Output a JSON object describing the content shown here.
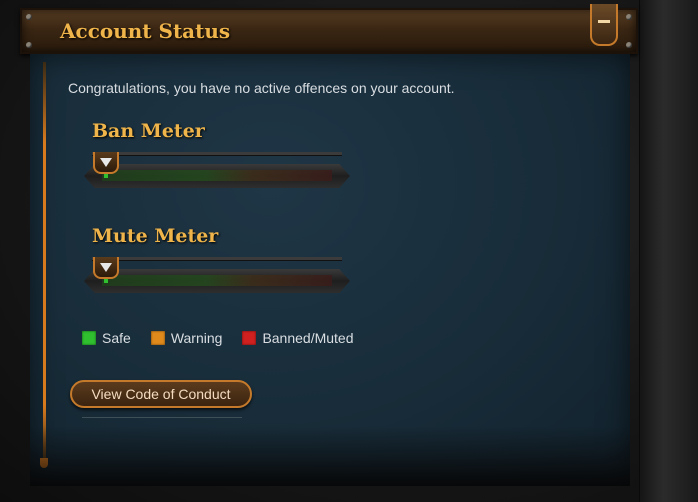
{
  "header": {
    "title": "Account Status"
  },
  "message": "Congratulations, you have no active offences on your account.",
  "meters": [
    {
      "title": "Ban Meter",
      "level": 0.0
    },
    {
      "title": "Mute Meter",
      "level": 0.0
    }
  ],
  "legend": [
    {
      "label": "Safe",
      "color": "#2fbf2f"
    },
    {
      "label": "Warning",
      "color": "#e08a1c"
    },
    {
      "label": "Banned/Muted",
      "color": "#d02020"
    }
  ],
  "actions": {
    "code_of_conduct": "View Code of Conduct"
  },
  "colors": {
    "accent": "#f0b54a",
    "border": "#c47a2a",
    "panel": "#182c39"
  },
  "icons": {
    "collapse": "minus-icon",
    "meter_indicator": "triangle-down-icon"
  }
}
